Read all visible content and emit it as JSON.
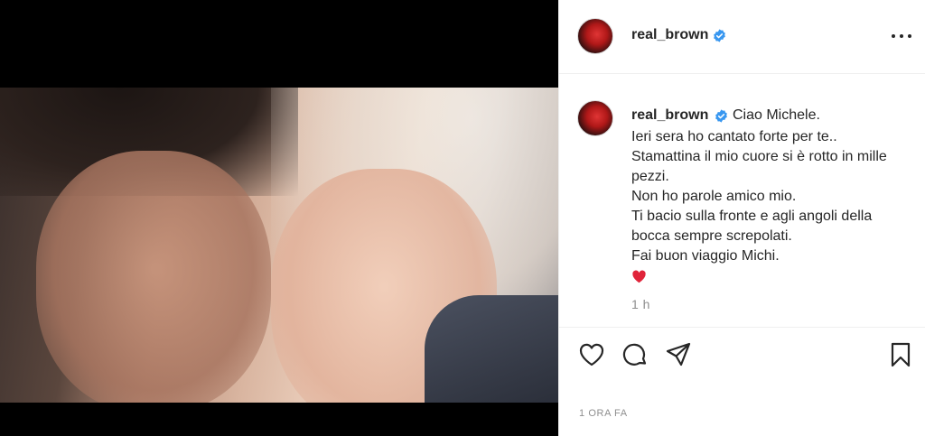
{
  "post": {
    "username": "real_brown",
    "caption": {
      "first_line": "Ciao Michele.",
      "lines": [
        "Ieri sera ho cantato forte per te..",
        "Stamattina il mio cuore si è rotto in mille pezzi.",
        "Non ho parole amico mio.",
        "Ti bacio sulla fronte e agli angoli della bocca sempre screpolati.",
        "Fai buon viaggio Michi."
      ],
      "emoji": "red-heart-emoji"
    },
    "caption_time": "1 h",
    "footer_time": "1 ORA FA"
  },
  "icons": {
    "verified": "verified-badge-icon",
    "more": "more-options-icon",
    "like": "heart-icon",
    "comment": "comment-icon",
    "share": "paper-plane-icon",
    "save": "bookmark-icon"
  },
  "colors": {
    "verified_blue": "#3897f0",
    "text": "#262626",
    "muted": "#8e8e8e",
    "heart_red": "#ed4956"
  }
}
